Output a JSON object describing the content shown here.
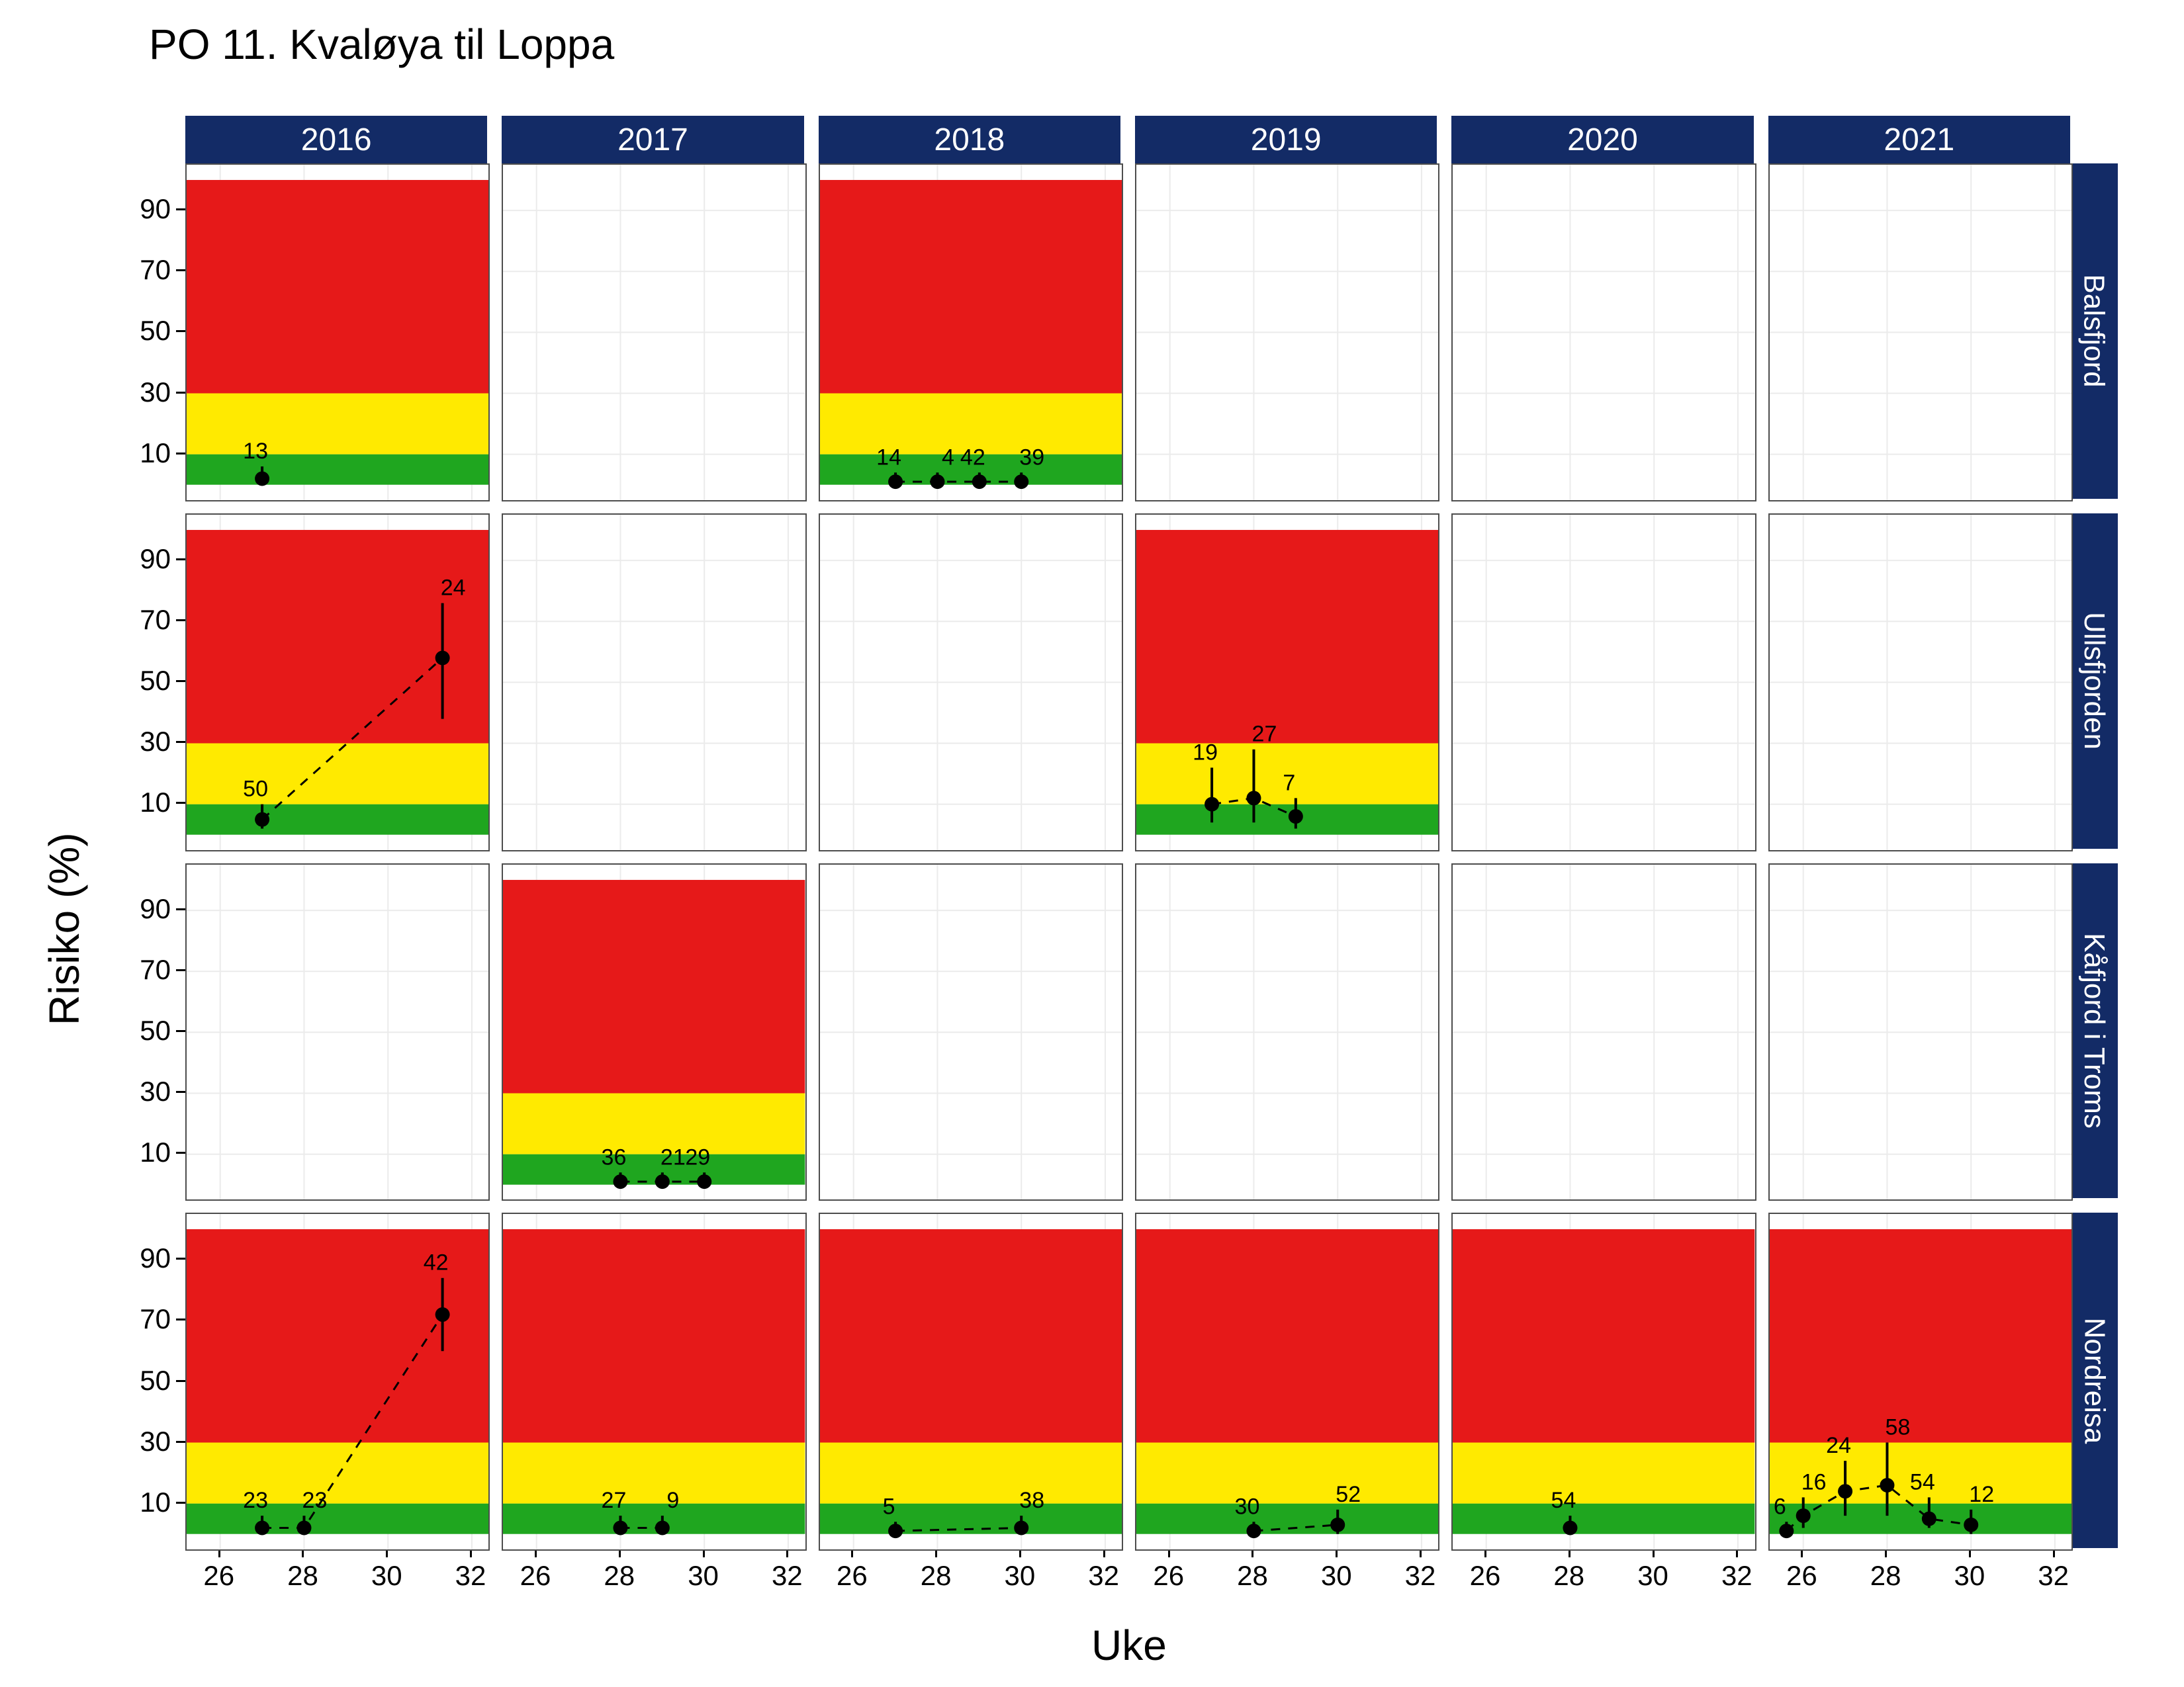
{
  "chart_data": {
    "type": "scatter",
    "title": "PO 11. Kvaløya til Loppa",
    "xlabel": "Uke",
    "ylabel": "Risiko (%)",
    "x_ticks": [
      26,
      28,
      30,
      32
    ],
    "y_ticks": [
      10,
      30,
      50,
      70,
      90
    ],
    "x_range": [
      25.2,
      32.4
    ],
    "y_range": [
      -5,
      105
    ],
    "col_facets": [
      "2016",
      "2017",
      "2018",
      "2019",
      "2020",
      "2021"
    ],
    "row_facets": [
      "Balsfjord",
      "Ullsfjorden",
      "Kåfjord i Troms",
      "Nordreisa"
    ],
    "bands": {
      "levels": [
        {
          "name": "green",
          "y0": 0,
          "y1": 10,
          "color": "#1fa61f"
        },
        {
          "name": "yellow",
          "y0": 10,
          "y1": 30,
          "color": "#ffea00"
        },
        {
          "name": "red",
          "y0": 30,
          "y1": 100,
          "color": "#e61919"
        }
      ]
    },
    "cells": {
      "Balsfjord": {
        "2016": {
          "bands": true,
          "points": [
            {
              "x": 27,
              "y": 2,
              "n": 13,
              "lo": 0,
              "hi": 6
            }
          ]
        },
        "2017": {
          "bands": false,
          "points": []
        },
        "2018": {
          "bands": true,
          "points": [
            {
              "x": 27,
              "y": 1,
              "n": 14,
              "lo": 0,
              "hi": 4
            },
            {
              "x": 28,
              "y": 1,
              "n": 4,
              "lo": 0,
              "hi": 4
            },
            {
              "x": 29,
              "y": 1,
              "n": 42,
              "lo": 0,
              "hi": 4
            },
            {
              "x": 30,
              "y": 1,
              "n": 39,
              "lo": 0,
              "hi": 4
            }
          ]
        },
        "2019": {
          "bands": false,
          "points": []
        },
        "2020": {
          "bands": false,
          "points": []
        },
        "2021": {
          "bands": false,
          "points": []
        }
      },
      "Ullsfjorden": {
        "2016": {
          "bands": true,
          "points": [
            {
              "x": 27,
              "y": 5,
              "n": 50,
              "lo": 2,
              "hi": 10
            },
            {
              "x": 31.3,
              "y": 58,
              "n": 24,
              "lo": 38,
              "hi": 76
            }
          ]
        },
        "2017": {
          "bands": false,
          "points": []
        },
        "2018": {
          "bands": false,
          "points": []
        },
        "2019": {
          "bands": true,
          "points": [
            {
              "x": 27,
              "y": 10,
              "n": 19,
              "lo": 4,
              "hi": 22
            },
            {
              "x": 28,
              "y": 12,
              "n": 27,
              "lo": 4,
              "hi": 28
            },
            {
              "x": 29,
              "y": 6,
              "n": 7,
              "lo": 2,
              "hi": 12
            }
          ]
        },
        "2020": {
          "bands": false,
          "points": []
        },
        "2021": {
          "bands": false,
          "points": []
        }
      },
      "Kåfjord i Troms": {
        "2016": {
          "bands": false,
          "points": []
        },
        "2017": {
          "bands": true,
          "points": [
            {
              "x": 28,
              "y": 1,
              "n": 36,
              "lo": 0,
              "hi": 4
            },
            {
              "x": 29,
              "y": 1,
              "n": 21,
              "lo": 0,
              "hi": 4
            },
            {
              "x": 30,
              "y": 1,
              "n": 29,
              "lo": 0,
              "hi": 4
            }
          ]
        },
        "2018": {
          "bands": false,
          "points": []
        },
        "2019": {
          "bands": false,
          "points": []
        },
        "2020": {
          "bands": false,
          "points": []
        },
        "2021": {
          "bands": false,
          "points": []
        }
      },
      "Nordreisa": {
        "2016": {
          "bands": true,
          "points": [
            {
              "x": 27,
              "y": 2,
              "n": 23,
              "lo": 0,
              "hi": 6
            },
            {
              "x": 28,
              "y": 2,
              "n": 23,
              "lo": 0,
              "hi": 6
            },
            {
              "x": 31.3,
              "y": 72,
              "n": 42,
              "lo": 60,
              "hi": 84
            }
          ]
        },
        "2017": {
          "bands": true,
          "points": [
            {
              "x": 28,
              "y": 2,
              "n": 27,
              "lo": 0,
              "hi": 6
            },
            {
              "x": 29,
              "y": 2,
              "n": 9,
              "lo": 0,
              "hi": 6
            }
          ]
        },
        "2018": {
          "bands": true,
          "points": [
            {
              "x": 27,
              "y": 1,
              "n": 5,
              "lo": 0,
              "hi": 4
            },
            {
              "x": 30,
              "y": 2,
              "n": 38,
              "lo": 0,
              "hi": 6
            }
          ]
        },
        "2019": {
          "bands": true,
          "points": [
            {
              "x": 28,
              "y": 1,
              "n": 30,
              "lo": 0,
              "hi": 4
            },
            {
              "x": 30,
              "y": 3,
              "n": 52,
              "lo": 0,
              "hi": 8
            }
          ]
        },
        "2020": {
          "bands": true,
          "points": [
            {
              "x": 28,
              "y": 2,
              "n": 54,
              "lo": 0,
              "hi": 6
            }
          ]
        },
        "2021": {
          "bands": true,
          "points": [
            {
              "x": 25.6,
              "y": 1,
              "n": 6,
              "lo": 0,
              "hi": 4
            },
            {
              "x": 26,
              "y": 6,
              "n": 16,
              "lo": 2,
              "hi": 12
            },
            {
              "x": 27,
              "y": 14,
              "n": 24,
              "lo": 6,
              "hi": 24
            },
            {
              "x": 28,
              "y": 16,
              "n": 58,
              "lo": 6,
              "hi": 30
            },
            {
              "x": 29,
              "y": 5,
              "n": 54,
              "lo": 2,
              "hi": 12
            },
            {
              "x": 30,
              "y": 3,
              "n": 12,
              "lo": 0,
              "hi": 8
            }
          ]
        }
      }
    }
  },
  "layout": {
    "stage_w": 3300,
    "stage_h": 2550,
    "title_x": 225,
    "title_y": 30,
    "plot_left": 280,
    "plot_top": 175,
    "plot_right": 3200,
    "plot_bottom": 2340,
    "strip_h": 72,
    "strip_w": 72,
    "panel_gap": 22,
    "ylab_y": 1550,
    "ylab_x": 60,
    "xlab_y": 2450,
    "y_tick_w": 78,
    "x_tick_gap": 12
  }
}
